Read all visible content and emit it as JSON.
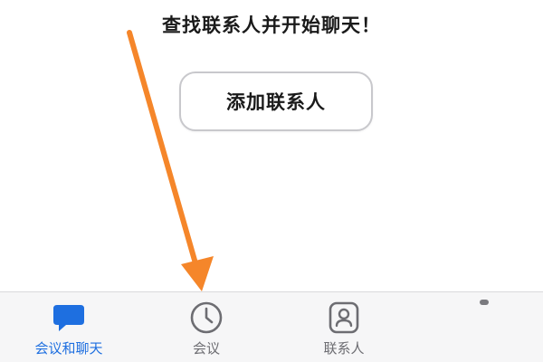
{
  "main": {
    "heading": "查找联系人并开始聊天！",
    "add_contact_label": "添加联系人"
  },
  "tabbar": {
    "tabs": [
      {
        "label": "会议和聊天",
        "icon": "chat-bubble-icon",
        "active": true
      },
      {
        "label": "会议",
        "icon": "clock-icon",
        "active": false
      },
      {
        "label": "联系人",
        "icon": "contact-card-icon",
        "active": false
      }
    ]
  },
  "colors": {
    "accent": "#1e6fe0",
    "inactive": "#6d6d72",
    "annotation_arrow": "#f5862a"
  }
}
